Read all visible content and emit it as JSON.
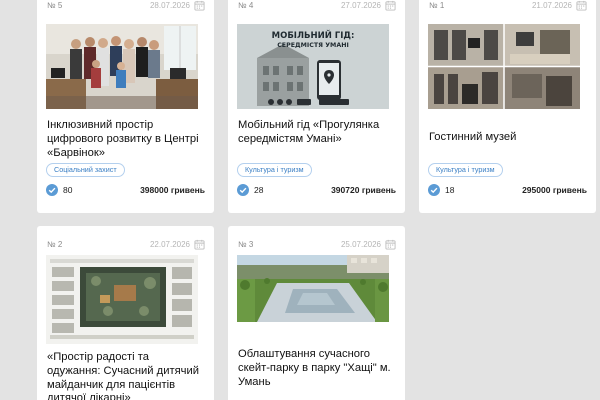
{
  "currency": "гривень",
  "colors": {
    "page_bg": "#e3e3e3",
    "card_bg": "#ffffff",
    "accent": "#3b7fc4",
    "check": "#5b9bd5"
  },
  "icons": {
    "calendar": "calendar-icon",
    "check": "check-circle-icon"
  },
  "cards": [
    {
      "no_prefix": "№",
      "number": "5",
      "date": "28.07.2026",
      "title": "Інклюзивний простір цифрового розвитку в Центрі «Барвінок»",
      "tag": "Соціальний захист",
      "votes": "80",
      "amount": "398000"
    },
    {
      "no_prefix": "№",
      "number": "4",
      "date": "27.07.2026",
      "title": "Мобільний гід «Прогулянка середмістям Умані»",
      "tag": "Культура і туризм",
      "votes": "28",
      "amount": "390720",
      "poster": {
        "line1": "МОБІЛЬНИЙ ГІД:",
        "line2": "СЕРЕДМІСТЯ УМАНІ"
      }
    },
    {
      "no_prefix": "№",
      "number": "1",
      "date": "21.07.2026",
      "title": "Гостинний музей",
      "tag": "Культура і туризм",
      "votes": "18",
      "amount": "295000"
    },
    {
      "no_prefix": "№",
      "number": "2",
      "date": "22.07.2026",
      "title": "«Простір радості та одужання: Сучасний дитячий майданчик для пацієнтів дитячої лікарні»"
    },
    {
      "no_prefix": "№",
      "number": "3",
      "date": "25.07.2026",
      "title": "Облаштування сучасного скейт-парку в парку \"Хащі\" м. Умань"
    }
  ]
}
